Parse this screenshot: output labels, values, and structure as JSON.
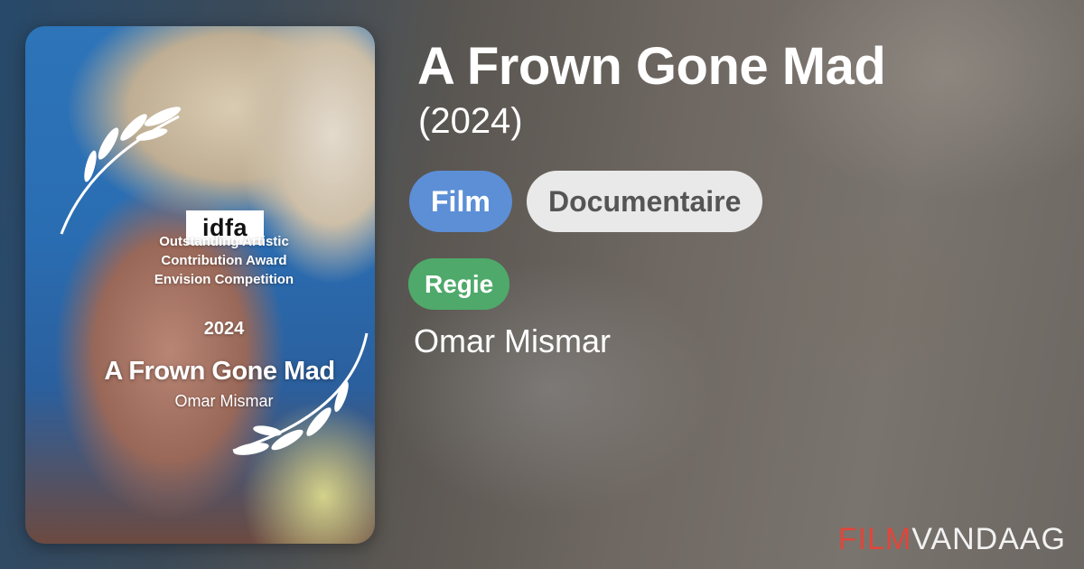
{
  "poster": {
    "badge": "idfa",
    "award_lines": [
      "Outstanding Artistic",
      "Contribution Award",
      "Envision Competition"
    ],
    "award_year": "2024",
    "title": "A Frown Gone Mad",
    "director": "Omar Mismar"
  },
  "movie": {
    "title": "A Frown Gone Mad",
    "year": "(2024)",
    "tags": [
      "Film",
      "Documentaire"
    ],
    "role_label": "Regie",
    "director": "Omar Mismar"
  },
  "brand": {
    "part1": "FILM",
    "part2": "VANDAAG"
  },
  "colors": {
    "film_chip": "#5c8fd6",
    "genre_chip": "#e9e9e9",
    "regie_chip": "#4ea96a",
    "brand_red": "#e0463a"
  }
}
